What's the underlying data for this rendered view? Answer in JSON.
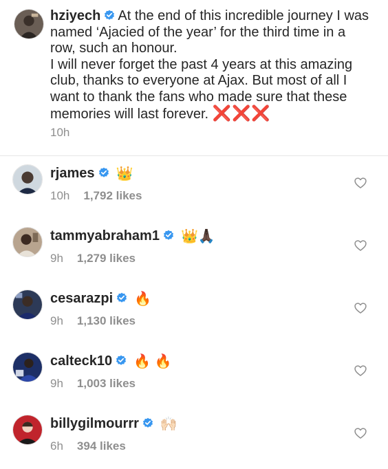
{
  "caption": {
    "username": "hziyech",
    "paragraph1": "At the end of this incredible journey I was named ‘Ajacied of the year’ for the third time in a row, such an honour.",
    "paragraph2": "I will never forget the past 4 years at this amazing club, thanks to everyone at Ajax. But most of all I want to thank the fans who made sure that these memories will last forever.",
    "marks": "❌❌❌",
    "time": "10h"
  },
  "comments": [
    {
      "username": "rjames",
      "text": "👑",
      "time": "10h",
      "likes": "1,792 likes"
    },
    {
      "username": "tammyabraham1",
      "text": "👑🙏🏿",
      "time": "9h",
      "likes": "1,279 likes"
    },
    {
      "username": "cesarazpi",
      "text": "🔥",
      "time": "9h",
      "likes": "1,130 likes"
    },
    {
      "username": "calteck10",
      "text": "🔥 🔥",
      "time": "9h",
      "likes": "1,003 likes"
    },
    {
      "username": "billygilmourrr",
      "text": "🙌🏻",
      "time": "6h",
      "likes": "394 likes"
    }
  ],
  "icons": {
    "verified": "verified-badge-icon",
    "heart": "heart-outline-icon"
  },
  "colors": {
    "verified": "#3897f0",
    "muted": "#8e8e8e",
    "x_marks": "#e0202b"
  }
}
